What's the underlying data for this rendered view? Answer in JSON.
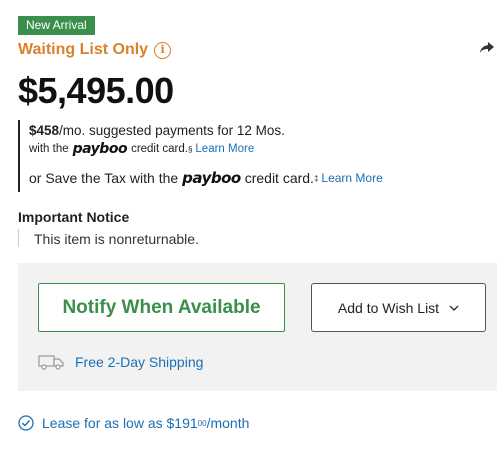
{
  "badge": "New Arrival",
  "availability": {
    "label": "Waiting List Only",
    "info_icon": "info-circle-icon"
  },
  "price": "$5,495.00",
  "financing": {
    "monthly_amount": "$458",
    "monthly_text": "/mo. suggested payments for 12 Mos.",
    "with_the": "with the",
    "logo": "payboo",
    "credit_card": "credit card.",
    "footnote_1": "§",
    "learn_more_1": "Learn More",
    "save_tax_prefix": "or Save the Tax with the",
    "credit_card_2": "credit card.",
    "footnote_2": "‡",
    "learn_more_2": "Learn More"
  },
  "notice": {
    "title": "Important Notice",
    "text": "This item is nonreturnable."
  },
  "actions": {
    "notify": "Notify When Available",
    "wishlist": "Add to Wish List",
    "wishlist_icon": "chevron-down-icon"
  },
  "shipping": {
    "label": "Free 2-Day Shipping",
    "icon": "truck-icon"
  },
  "lease": {
    "prefix": "Lease for as low as",
    "amount": "$191",
    "cents": "00",
    "suffix": "/month",
    "icon": "check-circle-icon"
  },
  "colors": {
    "green": "#3a8f4c",
    "orange": "#d9822b",
    "link": "#1a6fb5",
    "panel": "#f2f2f2"
  }
}
